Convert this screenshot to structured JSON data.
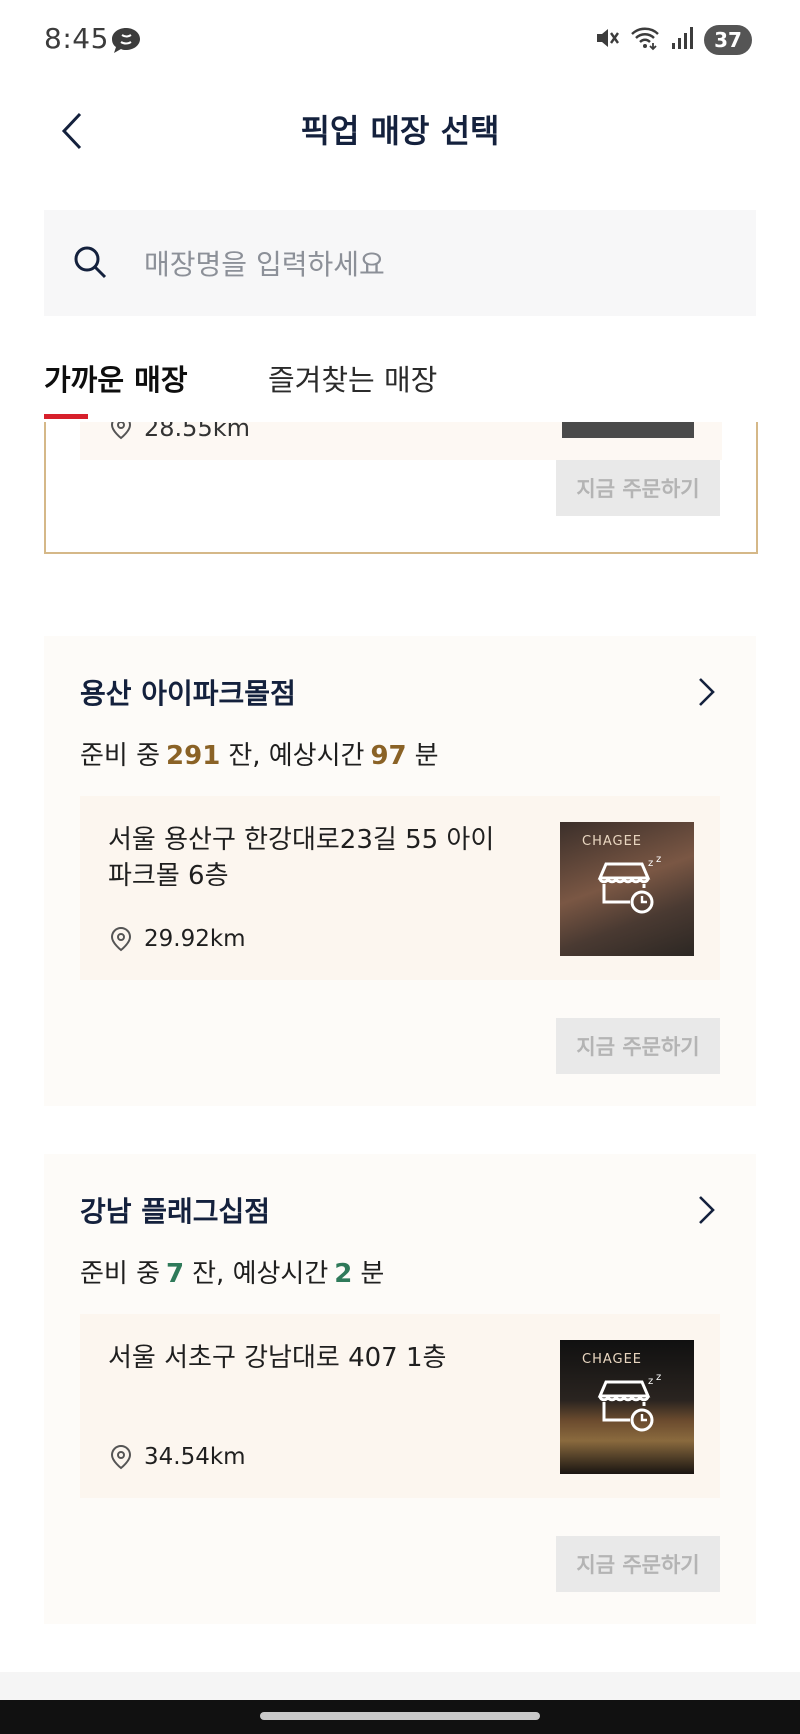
{
  "status_bar": {
    "time": "8:45",
    "battery": "37",
    "icons": [
      "chat-bubble-icon",
      "mute-icon",
      "wifi-icon",
      "signal-icon"
    ]
  },
  "header": {
    "title": "픽업 매장 선택",
    "back_icon": "chevron-left-icon"
  },
  "search": {
    "placeholder": "매장명을 입력하세요",
    "value": ""
  },
  "tabs": [
    {
      "label": "가까운 매장",
      "active": true
    },
    {
      "label": "즐겨찾는 매장",
      "active": false
    }
  ],
  "colors": {
    "accent_red": "#d7202b",
    "highlight_border": "#d5b888",
    "prep_brown": "#8a6226",
    "prep_green": "#2f7a5a",
    "disabled_button": "#e9e9e9"
  },
  "partial_store": {
    "distance": "28.55km",
    "order_label": "지금 주문하기"
  },
  "stores": [
    {
      "name": "용산 아이파크몰점",
      "prep_prefix": "준비 중",
      "prep_count": "291",
      "prep_mid": "잔, 예상시간",
      "prep_minutes": "97",
      "prep_suffix": "분",
      "address": "서울 용산구 한강대로23길 55 아이파크몰 6층",
      "distance": "29.92km",
      "photo_brand": "CHAGEE",
      "order_label": "지금 주문하기"
    },
    {
      "name": "강남 플래그십점",
      "prep_prefix": "준비 중",
      "prep_count": "7",
      "prep_mid": "잔, 예상시간",
      "prep_minutes": "2",
      "prep_suffix": "분",
      "address": "서울 서초구 강남대로 407 1층",
      "distance": "34.54km",
      "photo_brand": "CHAGEE",
      "order_label": "지금 주문하기"
    }
  ]
}
